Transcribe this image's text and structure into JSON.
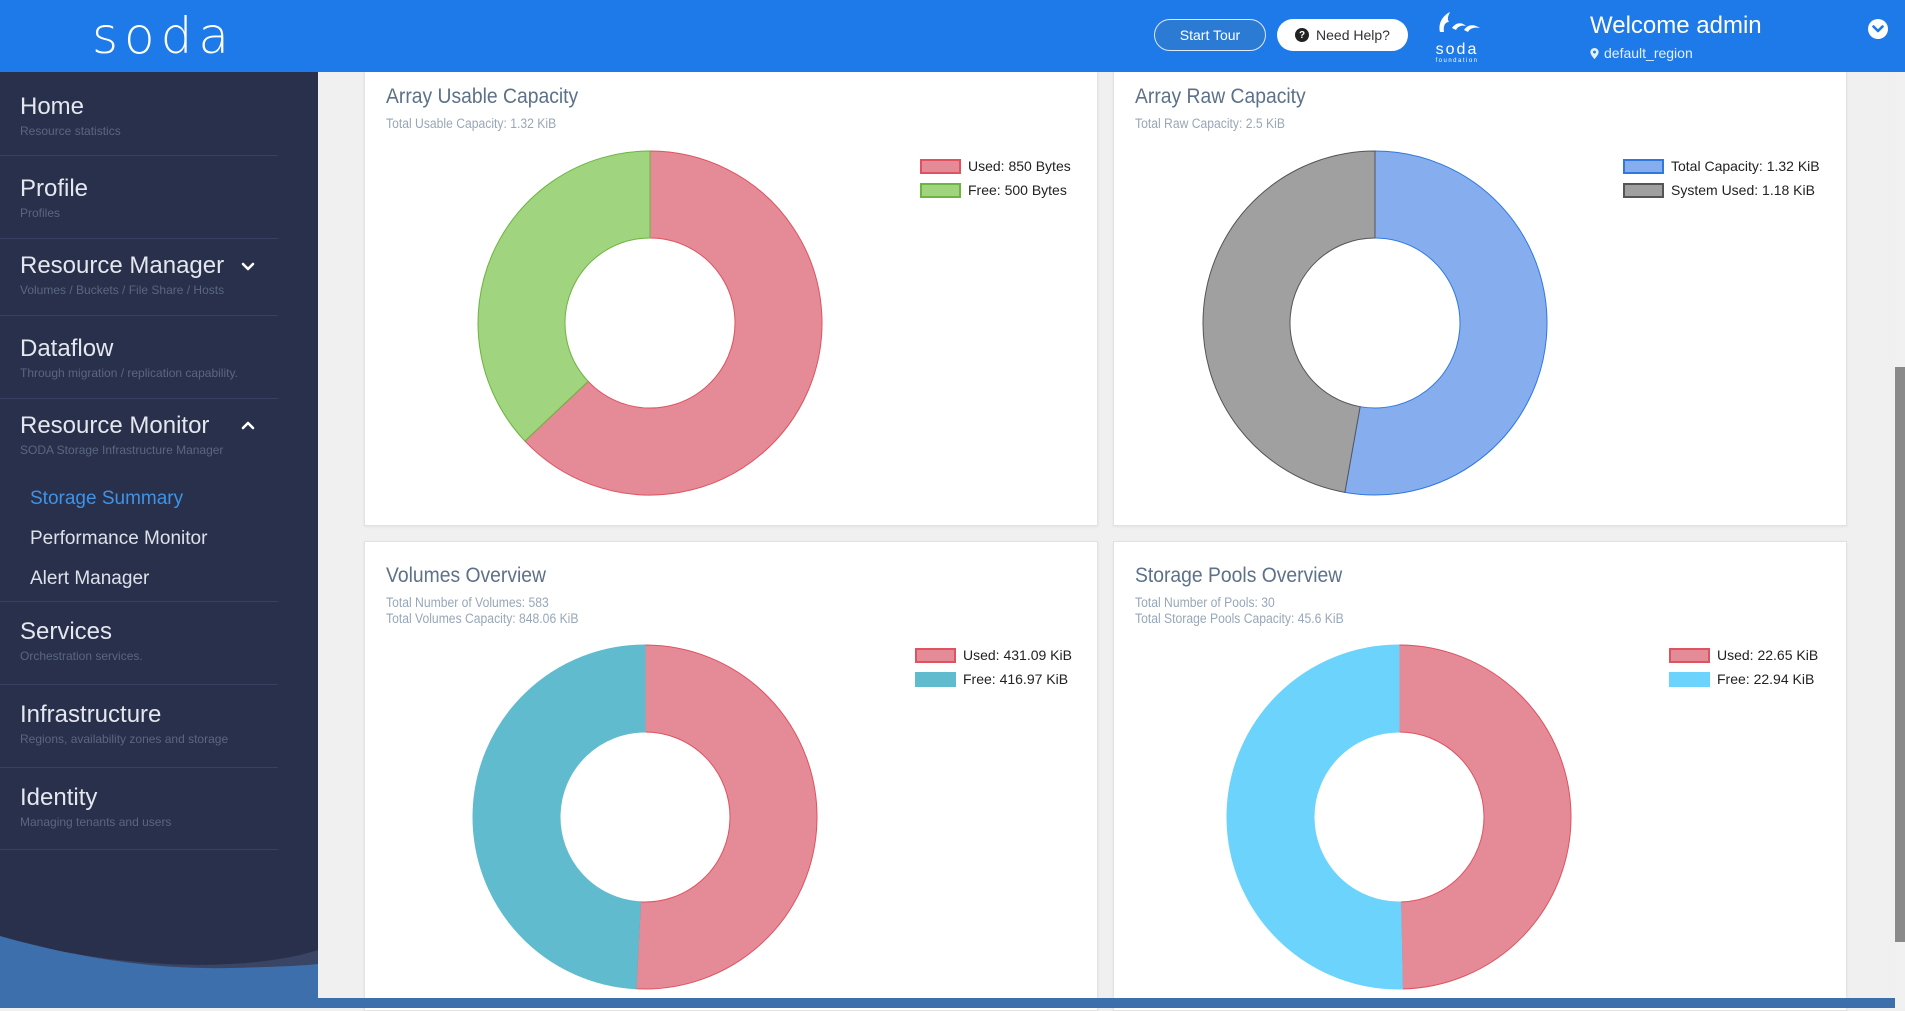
{
  "header": {
    "logo_text": "soda",
    "start_tour_label": "Start Tour",
    "need_help_label": "Need Help?",
    "foundation_logo_name": "soda",
    "foundation_logo_sub": "foundation",
    "welcome_text": "Welcome admin",
    "region": "default_region"
  },
  "sidebar": {
    "items": [
      {
        "title": "Home",
        "subtitle": "Resource statistics"
      },
      {
        "title": "Profile",
        "subtitle": "Profiles"
      },
      {
        "title": "Resource Manager",
        "subtitle": "Volumes / Buckets / File Share / Hosts",
        "chevron": "chevron-down"
      },
      {
        "title": "Dataflow",
        "subtitle": "Through migration / replication capability."
      },
      {
        "title": "Resource Monitor",
        "subtitle": "SODA Storage Infrastructure Manager",
        "chevron": "chevron-up",
        "children": [
          {
            "label": "Storage Summary",
            "active": true
          },
          {
            "label": "Performance Monitor"
          },
          {
            "label": "Alert Manager"
          }
        ]
      },
      {
        "title": "Services",
        "subtitle": "Orchestration services."
      },
      {
        "title": "Infrastructure",
        "subtitle": "Regions, availability zones and storage"
      },
      {
        "title": "Identity",
        "subtitle": "Managing tenants and users"
      }
    ]
  },
  "colors": {
    "header_bg": "#1e7ae8",
    "sidebar_bg": "#28304b",
    "active_link": "#3f93e6",
    "used_red": "#e58a97",
    "free_green": "#a1d47e",
    "total_blue": "#86aeee",
    "system_gray": "#a0a0a0",
    "free_teal": "#61bbce",
    "free_cyan": "#6bd3fc"
  },
  "chart_data": [
    {
      "type": "pie",
      "variant": "doughnut",
      "title": "Array Usable Capacity",
      "subtitles": [
        "Total Usable Capacity: 1.32 KiB"
      ],
      "legend_position": "top-right",
      "slices": [
        {
          "label": "Used: 850 Bytes",
          "value": 850,
          "color": "#e58a97",
          "stroke": "#e0525f"
        },
        {
          "label": "Free: 500 Bytes",
          "value": 500,
          "color": "#a1d47e",
          "stroke": "#6cb53f"
        }
      ]
    },
    {
      "type": "pie",
      "variant": "doughnut",
      "title": "Array Raw Capacity",
      "subtitles": [
        "Total Raw Capacity: 2.5 KiB"
      ],
      "legend_position": "top-right",
      "slices": [
        {
          "label": "Total Capacity: 1.32 KiB",
          "value": 1.32,
          "color": "#86aeee",
          "stroke": "#2f78e0"
        },
        {
          "label": "System Used: 1.18 KiB",
          "value": 1.18,
          "color": "#a0a0a0",
          "stroke": "#555555"
        }
      ]
    },
    {
      "type": "pie",
      "variant": "doughnut",
      "title": "Volumes Overview",
      "subtitles": [
        "Total Number of Volumes: 583",
        "Total Volumes Capacity: 848.06 KiB"
      ],
      "legend_position": "top-right",
      "slices": [
        {
          "label": "Used: 431.09 KiB",
          "value": 431.09,
          "color": "#e58a97",
          "stroke": "#e0525f"
        },
        {
          "label": "Free: 416.97 KiB",
          "value": 416.97,
          "color": "#61bbce",
          "stroke": "#61bbce"
        }
      ]
    },
    {
      "type": "pie",
      "variant": "doughnut",
      "title": "Storage Pools Overview",
      "subtitles": [
        "Total Number of Pools: 30",
        "Total Storage Pools Capacity: 45.6 KiB"
      ],
      "legend_position": "top-right",
      "slices": [
        {
          "label": "Used: 22.65 KiB",
          "value": 22.65,
          "color": "#e58a97",
          "stroke": "#e0525f"
        },
        {
          "label": "Free: 22.94 KiB",
          "value": 22.94,
          "color": "#6bd3fc",
          "stroke": "#6bd3fc"
        }
      ]
    }
  ]
}
